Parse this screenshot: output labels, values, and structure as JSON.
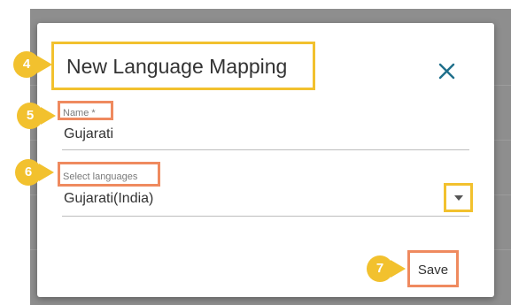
{
  "dialog": {
    "title": "New Language Mapping",
    "close_icon": "close-icon"
  },
  "fields": {
    "name": {
      "label": "Name *",
      "value": "Gujarati"
    },
    "languages": {
      "label": "Select languages",
      "value": "Gujarati(India)",
      "dropdown_icon": "chevron-down-icon"
    }
  },
  "actions": {
    "save_label": "Save"
  },
  "callouts": [
    "4",
    "5",
    "6",
    "7"
  ],
  "colors": {
    "callout": "#f2c12e",
    "highlight_yellow": "#f2c12e",
    "highlight_orange": "#ef8a5f",
    "accent": "#1f6f8b",
    "overlay": "#8e8e8e"
  }
}
